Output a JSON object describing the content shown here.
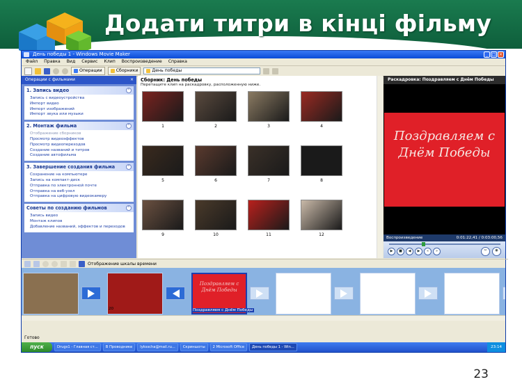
{
  "slide": {
    "title": "Додати титри в кінці фільму",
    "page_number": "23"
  },
  "window": {
    "title": "День победы 1 - Windows Movie Maker",
    "menu": [
      "Файл",
      "Правка",
      "Вид",
      "Сервис",
      "Клип",
      "Воспроизведение",
      "Справка"
    ],
    "toolbar": {
      "operations_label": "Операции",
      "collections_label": "Сборники",
      "collection_select_value": "День победы"
    }
  },
  "tasks_pane": {
    "header": "Операции с фильмами",
    "sections": [
      {
        "title": "1. Запись видео",
        "items": [
          "Запись с видеоустройства",
          "Импорт видео",
          "Импорт изображений",
          "Импорт звука или музыки"
        ]
      },
      {
        "title": "2. Монтаж фильма",
        "items": [
          "Отображение сборников",
          "Просмотр видеоэффектов",
          "Просмотр видеопереходов",
          "Создание названий и титров",
          "Создание автофильма"
        ]
      },
      {
        "title": "3. Завершение создания фильма",
        "items": [
          "Сохранение на компьютере",
          "Запись на компакт-диск",
          "Отправка по электронной почте",
          "Отправка на веб-узел",
          "Отправка на цифровую видеокамеру"
        ]
      },
      {
        "title": "Советы по созданию фильмов",
        "items": [
          "Запись видео",
          "Монтаж клипов",
          "Добавление названий, эффектов и переходов"
        ]
      }
    ]
  },
  "collection": {
    "title": "Сборник: День победы",
    "subtitle": "Перетащите клип на раскадровку, расположенную ниже.",
    "clips": [
      {
        "number": "1",
        "color": "#7a2320"
      },
      {
        "number": "2",
        "color": "#5a4a3e"
      },
      {
        "number": "3",
        "color": "#8a7a62"
      },
      {
        "number": "4",
        "color": "#9a2a22"
      },
      {
        "number": "5",
        "color": "#3a2a1e"
      },
      {
        "number": "6",
        "color": "#5a3a2e"
      },
      {
        "number": "7",
        "color": "#3a3028"
      },
      {
        "number": "8",
        "color": "#1a1a1a"
      },
      {
        "number": "9",
        "color": "#6a5040"
      },
      {
        "number": "10",
        "color": "#4a3a2a"
      },
      {
        "number": "11",
        "color": "#b8201c"
      },
      {
        "number": "12",
        "color": "#c9b9a8"
      }
    ]
  },
  "preview": {
    "header": "Раскадровка: Поздравляем с Днём Победы",
    "card_text": "Поздравляем с Днём Победы",
    "status_label": "Воспроизведение",
    "time": "0:01:22,41 / 0:03:00,56",
    "position_fraction": 0.46
  },
  "storyboard": {
    "toolbar_label": "Отображение шкалы времени",
    "frames": [
      {
        "label": "",
        "color": "#8a7050"
      },
      {
        "label": "20",
        "color": "#a01a18"
      },
      {
        "label": "Поздравляем с Днём Победы",
        "color": "#e02028",
        "card_text": "Поздравляем с Днём Победы"
      },
      {
        "label": "",
        "color": "#ffffff"
      },
      {
        "label": "",
        "color": "#ffffff"
      },
      {
        "label": "",
        "color": "#ffffff"
      }
    ]
  },
  "status_bar": {
    "text": "Готово"
  },
  "taskbar": {
    "start_label": "пуск",
    "apps": [
      "Drugs1 - Главная ст...",
      "В Проводнике",
      "lyksscha@mail.ru...",
      "Скриншоты",
      "2 Microsoft Office",
      "День победы 1 - Win..."
    ],
    "clock": "23:14"
  }
}
